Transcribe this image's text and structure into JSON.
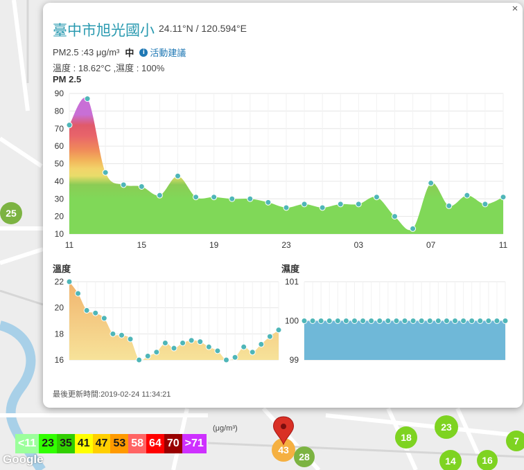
{
  "station": {
    "name": "臺中市旭光國小",
    "coords": "24.11°N / 120.594°E",
    "pm25_text": "PM2.5 :43 μg/m³",
    "level": "中",
    "advice_link": "活動建議",
    "weather_text": "溫度 : 18.62°C ,濕度 : 100%",
    "updated_label": "最後更新時間:",
    "updated_time": "2019-02-24 11:34:21",
    "close_glyph": "×"
  },
  "map": {
    "markers": [
      {
        "label": "25",
        "color": "#7cb342"
      },
      {
        "label": "43",
        "color": "#f5b041"
      },
      {
        "label": "28",
        "color": "#7cb342"
      },
      {
        "label": "18",
        "color": "#7ed321"
      },
      {
        "label": "23",
        "color": "#7ed321"
      },
      {
        "label": "7",
        "color": "#7ed321"
      },
      {
        "label": "14",
        "color": "#7ed321"
      },
      {
        "label": "16",
        "color": "#7ed321"
      }
    ],
    "legend_unit": "(μg/m³)",
    "legend": [
      {
        "label": "<11",
        "bg": "#9cff9c",
        "fg": "#ffffff"
      },
      {
        "label": "23",
        "bg": "#31ff00",
        "fg": "#1a1a1a"
      },
      {
        "label": "35",
        "bg": "#31cf00",
        "fg": "#1a1a1a"
      },
      {
        "label": "41",
        "bg": "#ffff00",
        "fg": "#1a1a1a"
      },
      {
        "label": "47",
        "bg": "#ffcf00",
        "fg": "#1a1a1a"
      },
      {
        "label": "53",
        "bg": "#ff9a00",
        "fg": "#1a1a1a"
      },
      {
        "label": "58",
        "bg": "#ff6464",
        "fg": "#ffffff"
      },
      {
        "label": "64",
        "bg": "#ff0000",
        "fg": "#ffffff"
      },
      {
        "label": "70",
        "bg": "#990000",
        "fg": "#ffffff"
      },
      {
        "label": ">71",
        "bg": "#ce30ff",
        "fg": "#ffffff"
      }
    ],
    "attribution": "Google"
  },
  "chart_data": [
    {
      "type": "area",
      "title": "PM 2.5",
      "ylim": [
        10,
        90
      ],
      "yticks": [
        10,
        20,
        30,
        40,
        50,
        60,
        70,
        80,
        90
      ],
      "xticks": [
        {
          "i": 0,
          "label": "11"
        },
        {
          "i": 4,
          "label": "15"
        },
        {
          "i": 8,
          "label": "19"
        },
        {
          "i": 12,
          "label": "23"
        },
        {
          "i": 16,
          "label": "03"
        },
        {
          "i": 20,
          "label": "07"
        },
        {
          "i": 24,
          "label": "11"
        }
      ],
      "x_count": 25,
      "values": [
        72,
        87,
        45,
        38,
        37,
        32,
        43,
        31,
        31,
        30,
        30,
        28,
        25,
        27,
        25,
        27,
        27,
        31,
        20,
        13,
        39,
        26,
        32,
        27,
        31
      ],
      "grid": true
    },
    {
      "type": "area",
      "title": "溫度",
      "ylim": [
        16,
        22
      ],
      "yticks": [
        16,
        18,
        20,
        22
      ],
      "values": [
        22,
        21.1,
        19.8,
        19.6,
        19.2,
        18,
        17.9,
        17.6,
        16,
        16.3,
        16.6,
        17.3,
        16.9,
        17.3,
        17.5,
        17.4,
        17,
        16.7,
        16,
        16.2,
        17,
        16.6,
        17.2,
        17.8,
        18.3
      ],
      "grid": true
    },
    {
      "type": "area",
      "title": "濕度",
      "ylim": [
        99,
        101
      ],
      "yticks": [
        99,
        100,
        101
      ],
      "values": [
        100,
        100,
        100,
        100,
        100,
        100,
        100,
        100,
        100,
        100,
        100,
        100,
        100,
        100,
        100,
        100,
        100,
        100,
        100,
        100,
        100,
        100,
        100,
        100,
        100
      ],
      "grid": true
    }
  ]
}
